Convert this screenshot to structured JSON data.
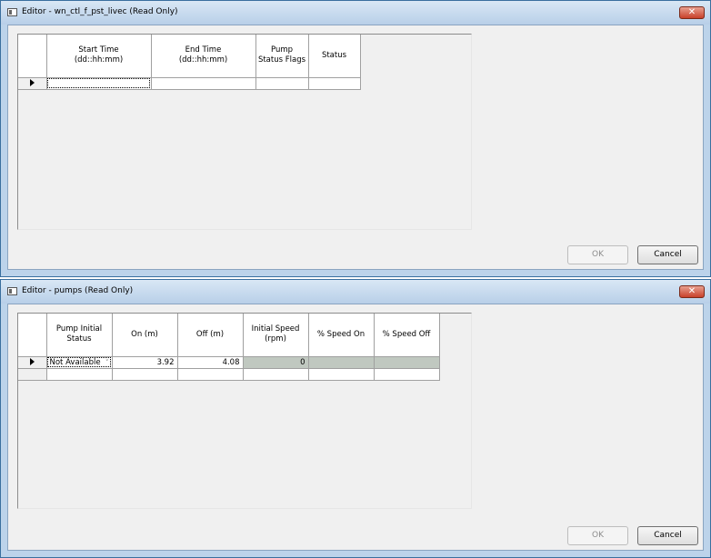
{
  "windows": [
    {
      "title": "Editor - wn_ctl_f_pst_livec (Read Only)",
      "close_glyph": "✕",
      "columns": [
        "Start Time\n(dd::hh:mm)",
        "End Time\n(dd::hh:mm)",
        "Pump\nStatus Flags",
        "Status"
      ],
      "rows": [
        [
          "",
          "",
          "",
          ""
        ]
      ],
      "ok_label": "OK",
      "cancel_label": "Cancel"
    },
    {
      "title": "Editor - pumps (Read Only)",
      "close_glyph": "✕",
      "columns": [
        "Pump Initial\nStatus",
        "On (m)",
        "Off (m)",
        "Initial Speed\n(rpm)",
        "% Speed On",
        "% Speed Off"
      ],
      "rows": [
        [
          "Not Available",
          "3.92",
          "4.08",
          "0",
          "",
          ""
        ],
        [
          "",
          "",
          "",
          "",
          "",
          ""
        ]
      ],
      "ok_label": "OK",
      "cancel_label": "Cancel"
    }
  ],
  "icons": {
    "window": "window-icon",
    "close": "close-icon",
    "row_selector": "current-row-arrow-icon",
    "dropdown": "chevron-down-icon"
  }
}
